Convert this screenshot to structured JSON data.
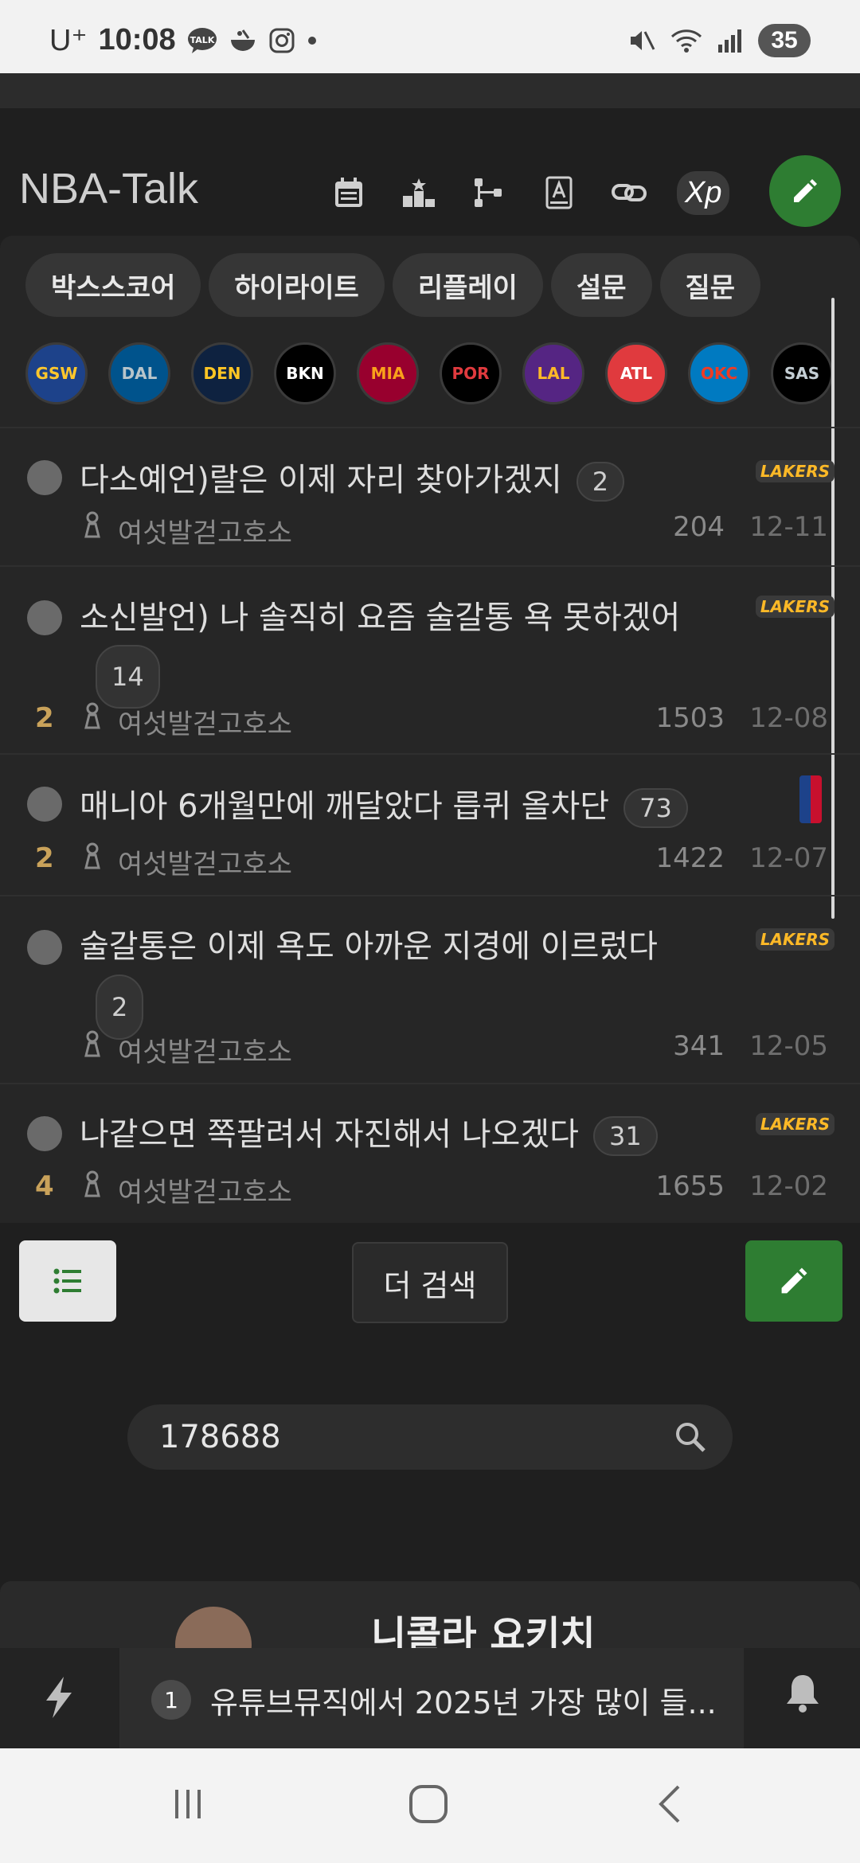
{
  "status_bar": {
    "carrier": "U⁺",
    "time": "10:08",
    "battery": "35"
  },
  "header": {
    "brand": "NBA-Talk",
    "xp_label": "Xp",
    "icons": [
      "calendar-icon",
      "ranking-icon",
      "tree-icon",
      "dictionary-icon",
      "link-icon"
    ]
  },
  "tabs": [
    "박스스코어",
    "하이라이트",
    "리플레이",
    "설문",
    "질문"
  ],
  "teams": [
    {
      "abbr": "GSW",
      "color": "#1d428a",
      "accent": "#ffc72c"
    },
    {
      "abbr": "DAL",
      "color": "#00538c",
      "accent": "#b8c4ca"
    },
    {
      "abbr": "DEN",
      "color": "#0e2240",
      "accent": "#fec524"
    },
    {
      "abbr": "BKN",
      "color": "#000000",
      "accent": "#ffffff"
    },
    {
      "abbr": "MIA",
      "color": "#98002e",
      "accent": "#f9a01b"
    },
    {
      "abbr": "POR",
      "color": "#000000",
      "accent": "#e03a3e"
    },
    {
      "abbr": "LAL",
      "color": "#552583",
      "accent": "#fdb927"
    },
    {
      "abbr": "ATL",
      "color": "#e03a3e",
      "accent": "#ffffff"
    },
    {
      "abbr": "OKC",
      "color": "#007ac1",
      "accent": "#ef3b24"
    },
    {
      "abbr": "SAS",
      "color": "#000000",
      "accent": "#c4ced4"
    }
  ],
  "posts": [
    {
      "title": "다소예언)랄은 이제 자리 찾아가겠지",
      "comments": "2",
      "recommend": "",
      "user": "여섯발걷고호소",
      "views": "204",
      "date": "12-11",
      "team_logo": "LAKERS"
    },
    {
      "title": "소신발언) 나 솔직히 요즘 술갈통 욕 못하겠어",
      "comments": "14",
      "recommend": "2",
      "user": "여섯발걷고호소",
      "views": "1503",
      "date": "12-08",
      "team_logo": "LAKERS"
    },
    {
      "title": "매니아 6개월만에 깨달았다 릅퀴 올차단",
      "comments": "73",
      "recommend": "2",
      "user": "여섯발걷고호소",
      "views": "1422",
      "date": "12-07",
      "team_logo": "NBA"
    },
    {
      "title": "술갈통은 이제 욕도 아까운 지경에 이르렀다",
      "comments": "2",
      "recommend": "",
      "user": "여섯발걷고호소",
      "views": "341",
      "date": "12-05",
      "team_logo": "LAKERS"
    },
    {
      "title": "나같으면 쪽팔려서 자진해서 나오겠다",
      "comments": "31",
      "recommend": "4",
      "user": "여섯발걷고호소",
      "views": "1655",
      "date": "12-02",
      "team_logo": "LAKERS"
    }
  ],
  "controls": {
    "more_search": "더 검색"
  },
  "search": {
    "value": "178688"
  },
  "player_card": {
    "name": "니콜라 요키치"
  },
  "ticker": {
    "rank": "1",
    "text": "유튜브뮤직에서 2025년 가장 많이 들..."
  },
  "colors": {
    "accent_green": "#2e7d32",
    "recommend_gold": "#c9a25a",
    "background": "#1f1f1f"
  }
}
